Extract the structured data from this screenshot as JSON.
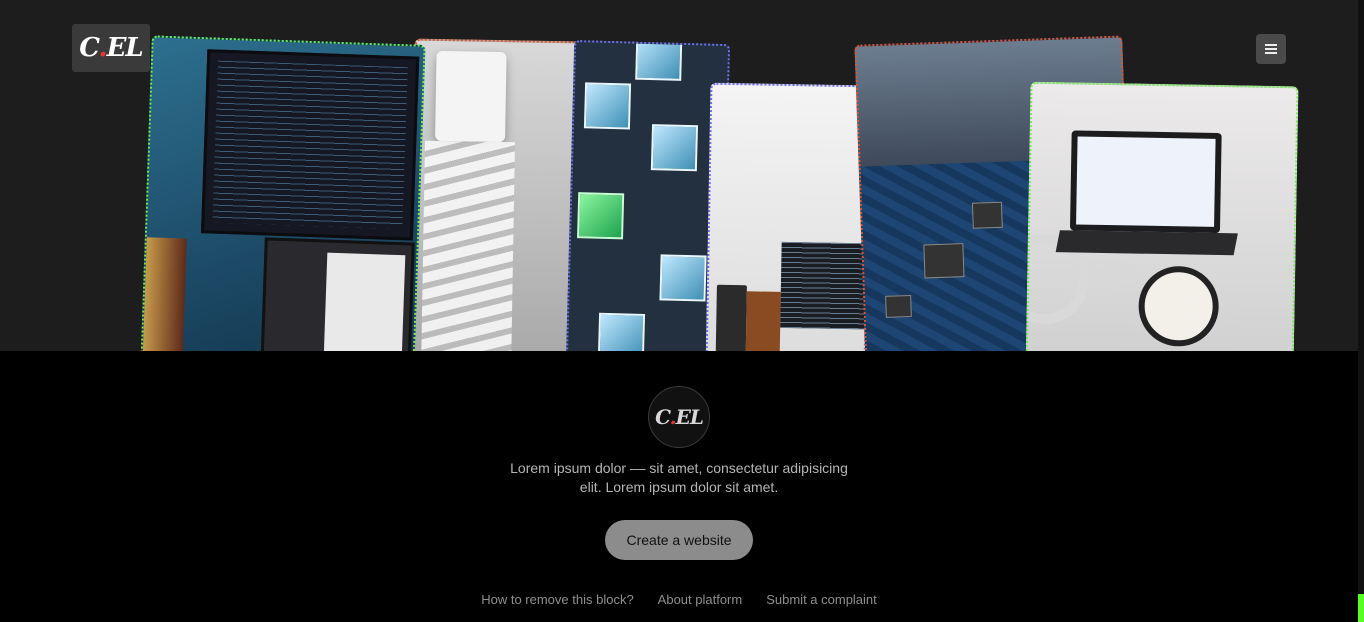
{
  "header": {
    "logo_main": "C",
    "logo_dot": ".",
    "logo_rest": "EL",
    "menu_icon": "hamburger-icon"
  },
  "hero": {
    "images": [
      "code-on-monitor-and-laptop",
      "3d-printer-printing-lattice",
      "glass-cubes-network",
      "workspace-with-code-screen",
      "circuit-board-closeup",
      "hands-testing-electronics-with-laptop"
    ]
  },
  "footer": {
    "logo_main": "C",
    "logo_dot": ".",
    "logo_rest": "EL",
    "description": "Lorem ipsum dolor –– sit amet, consectetur adipisicing elit. Lorem ipsum dolor sit amet.",
    "cta_label": "Create a website",
    "links": [
      "How to remove this block?",
      "About platform",
      "Submit a complaint"
    ]
  },
  "colors": {
    "accent_green": "#6cf04b",
    "accent_orange": "#e0552f",
    "accent_blue": "#6f6ff0",
    "logo_dot": "#e33333"
  }
}
